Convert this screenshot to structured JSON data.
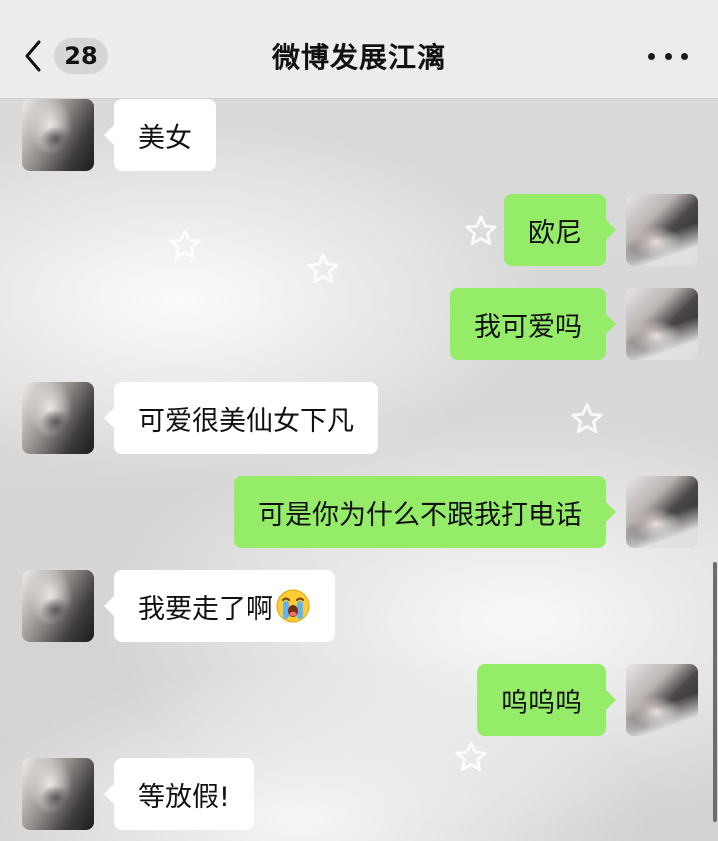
{
  "header": {
    "title": "微博发展江漓",
    "unread_count": "28",
    "back_icon": "chevron-left-icon",
    "more_icon": "more-dots-icon"
  },
  "colors": {
    "sent_bubble": "#95ec69",
    "received_bubble": "#ffffff",
    "header_bg": "#ededed"
  },
  "messages": [
    {
      "side": "left",
      "text": "美女"
    },
    {
      "side": "right",
      "text": "欧尼"
    },
    {
      "side": "right",
      "text": "我可爱吗"
    },
    {
      "side": "left",
      "text": "可爱很美仙女下凡"
    },
    {
      "side": "right",
      "text": "可是你为什么不跟我打电话"
    },
    {
      "side": "left",
      "text": "我要走了啊",
      "emoji": "loudly-crying-face-icon"
    },
    {
      "side": "right",
      "text": "呜呜呜"
    },
    {
      "side": "left",
      "text": "等放假!"
    }
  ]
}
